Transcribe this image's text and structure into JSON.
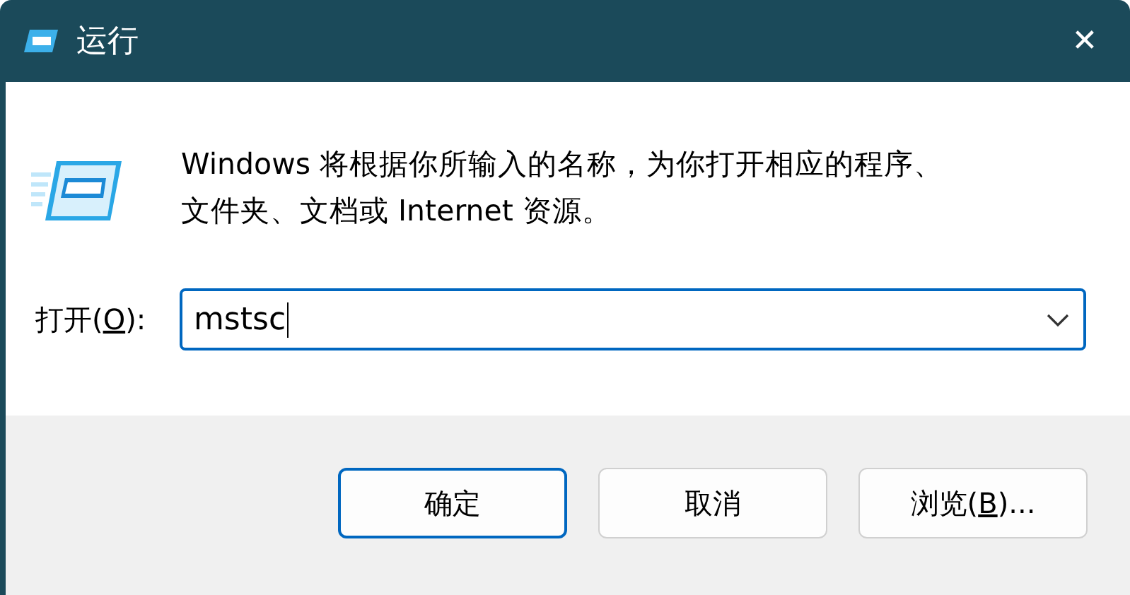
{
  "window": {
    "title": "运行",
    "close": "✕"
  },
  "description": "Windows 将根据你所输入的名称，为你打开相应的程序、文件夹、文档或 Internet 资源。",
  "open_field": {
    "label_before": "打开(",
    "access_key": "O",
    "label_after": "):",
    "value": "mstsc"
  },
  "buttons": [
    {
      "before": "确定",
      "default": true
    },
    {
      "before": "取消",
      "default": false
    },
    {
      "before": "浏览(",
      "access_key": "B",
      "after": ")...",
      "default": false
    }
  ]
}
